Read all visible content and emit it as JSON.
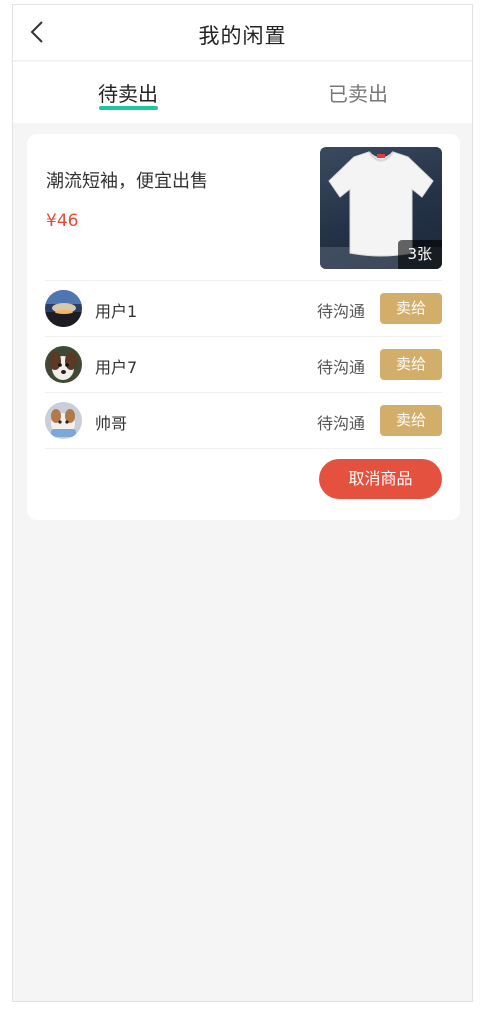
{
  "header": {
    "title": "我的闲置",
    "back_icon": "chevron-left-icon"
  },
  "tabs": [
    {
      "label": "待卖出",
      "active": true
    },
    {
      "label": "已卖出",
      "active": false
    }
  ],
  "product": {
    "title": "潮流短袖，便宜出售",
    "price": "¥46",
    "image_count": "3张",
    "image_icon": "white-tshirt-image"
  },
  "buyers": [
    {
      "name": "用户1",
      "status": "待沟通",
      "action": "卖给",
      "avatar": "sunset-avatar"
    },
    {
      "name": "用户7",
      "status": "待沟通",
      "action": "卖给",
      "avatar": "dog-avatar"
    },
    {
      "name": "帅哥",
      "status": "待沟通",
      "action": "卖给",
      "avatar": "pet-avatar"
    }
  ],
  "actions": {
    "cancel_label": "取消商品"
  },
  "colors": {
    "accent_tab": "#1dc8a0",
    "price": "#e54b3c",
    "sell_button": "#d3ae6a",
    "cancel_button": "#e5513f",
    "background": "#f5f5f5"
  }
}
